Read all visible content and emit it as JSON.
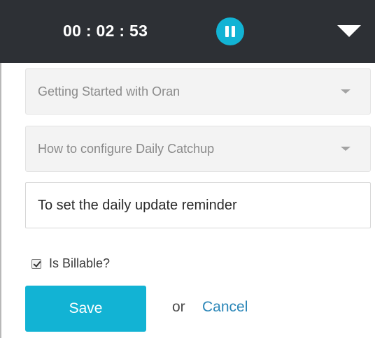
{
  "timer": {
    "time": "00 : 02 : 53",
    "pause_icon": "pause-icon",
    "dropdown_icon": "caret-down-icon"
  },
  "project_select": {
    "selected": "Getting Started with Oran"
  },
  "task_select": {
    "selected": "How to configure Daily Catchup"
  },
  "description_input": {
    "value": "To set the daily update reminder"
  },
  "billable": {
    "label": "Is Billable?",
    "checked": true
  },
  "actions": {
    "save_label": "Save",
    "or_text": "or",
    "cancel_label": "Cancel"
  },
  "colors": {
    "header_bg": "#2d3035",
    "accent": "#12b3d4",
    "link": "#2a86b8"
  }
}
